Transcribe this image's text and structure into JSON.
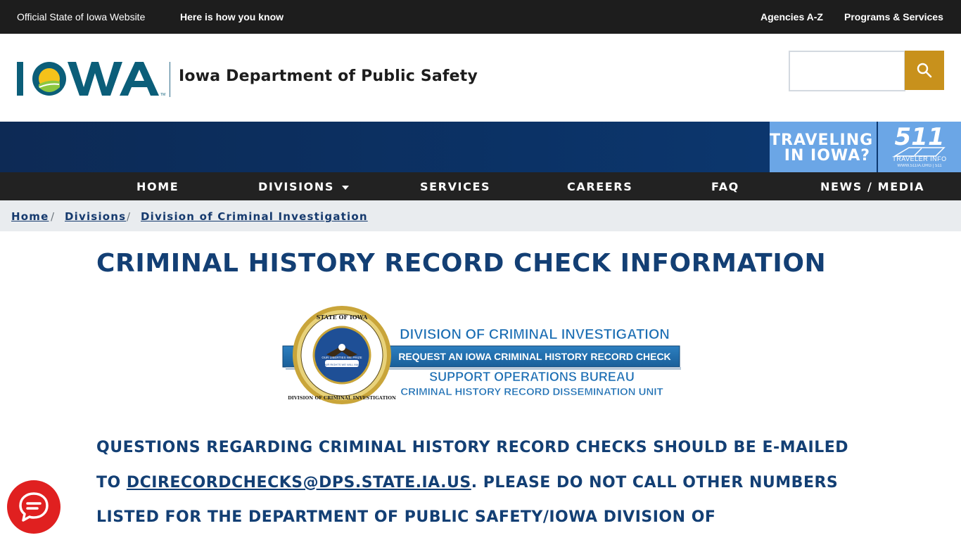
{
  "topbar": {
    "official": "Official State of Iowa Website",
    "how_you_know": "Here is how you know",
    "agencies": "Agencies A-Z",
    "programs": "Programs & Services"
  },
  "header": {
    "logo_text": "IOWA",
    "dept_name": "Iowa Department of Public Safety",
    "search_placeholder": ""
  },
  "banner": {
    "travel_line1": "TRAVELING",
    "travel_line2": "IN IOWA?",
    "b511_number": "511",
    "b511_label": "TRAVELER INFO",
    "b511_url": "WWW.511IA.ORG | 511"
  },
  "nav": {
    "items": [
      "HOME",
      "DIVISIONS",
      "SERVICES",
      "CAREERS",
      "FAQ",
      "NEWS / MEDIA"
    ]
  },
  "breadcrumb": {
    "items": [
      "Home",
      "Divisions",
      "Division of Criminal Investigation"
    ]
  },
  "main": {
    "title": "CRIMINAL HISTORY RECORD CHECK INFORMATION",
    "dci_banner": {
      "seal_top": "STATE OF IOWA",
      "seal_bottom": "DIVISION OF CRIMINAL INVESTIGATION",
      "seal_ribbon1": "OUR LIBERTIES WE PRIZE",
      "seal_ribbon2": "AND OUR RIGHTS WE WILL MAINTAIN",
      "line1": "DIVISION OF CRIMINAL INVESTIGATION",
      "line2": "REQUEST AN IOWA CRIMINAL HISTORY RECORD CHECK",
      "line3": "SUPPORT OPERATIONS BUREAU",
      "line4": "CRIMINAL HISTORY RECORD DISSEMINATION UNIT"
    },
    "body_part1": "QUESTIONS REGARDING CRIMINAL HISTORY RECORD CHECKS SHOULD BE E-MAILED TO ",
    "email": "DCIRECORDCHECKS@DPS.STATE.IA.US",
    "body_part2": ".  PLEASE DO NOT CALL OTHER NUMBERS LISTED FOR THE DEPARTMENT OF PUBLIC SAFETY/IOWA DIVISION OF"
  },
  "colors": {
    "dark_bar": "#1d1d1d",
    "navy": "#133f74",
    "gold": "#c8911c",
    "light_blue": "#6ba6e6",
    "chat_red": "#e02020"
  }
}
